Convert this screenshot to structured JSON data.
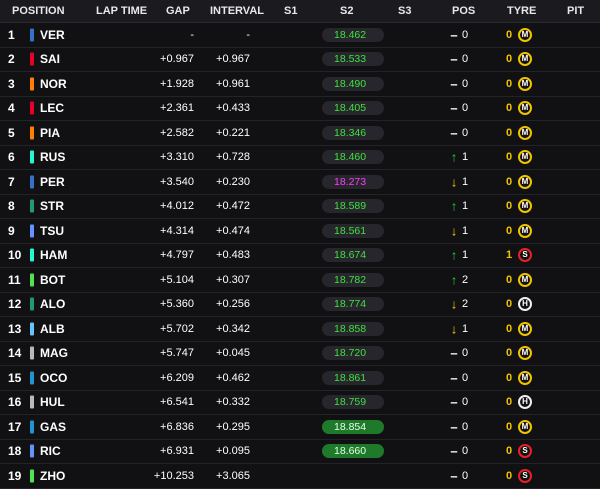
{
  "headers": {
    "position": "POSITION",
    "lap_time": "LAP TIME",
    "gap": "GAP",
    "interval": "INTERVAL",
    "s1": "S1",
    "s2": "S2",
    "s3": "S3",
    "pos": "POS",
    "tyre": "TYRE",
    "pit": "PIT"
  },
  "rows": [
    {
      "pos": "1",
      "code": "VER",
      "team_color": "#3671c6",
      "gap": "-",
      "interval": "-",
      "s2": "18.462",
      "s2_style": "normal",
      "pos_change": "0",
      "direction": "none",
      "pit": "0",
      "tyre": "M",
      "tyre_color": "#f2c400"
    },
    {
      "pos": "2",
      "code": "SAI",
      "team_color": "#e8002d",
      "gap": "+0.967",
      "interval": "+0.967",
      "s2": "18.533",
      "s2_style": "normal",
      "pos_change": "0",
      "direction": "none",
      "pit": "0",
      "tyre": "M",
      "tyre_color": "#f2c400"
    },
    {
      "pos": "3",
      "code": "NOR",
      "team_color": "#ff8000",
      "gap": "+1.928",
      "interval": "+0.961",
      "s2": "18.490",
      "s2_style": "normal",
      "pos_change": "0",
      "direction": "none",
      "pit": "0",
      "tyre": "M",
      "tyre_color": "#f2c400"
    },
    {
      "pos": "4",
      "code": "LEC",
      "team_color": "#e8002d",
      "gap": "+2.361",
      "interval": "+0.433",
      "s2": "18.405",
      "s2_style": "normal",
      "pos_change": "0",
      "direction": "none",
      "pit": "0",
      "tyre": "M",
      "tyre_color": "#f2c400"
    },
    {
      "pos": "5",
      "code": "PIA",
      "team_color": "#ff8000",
      "gap": "+2.582",
      "interval": "+0.221",
      "s2": "18.346",
      "s2_style": "normal",
      "pos_change": "0",
      "direction": "none",
      "pit": "0",
      "tyre": "M",
      "tyre_color": "#f2c400"
    },
    {
      "pos": "6",
      "code": "RUS",
      "team_color": "#27f4d2",
      "gap": "+3.310",
      "interval": "+0.728",
      "s2": "18.460",
      "s2_style": "normal",
      "pos_change": "1",
      "direction": "up",
      "pit": "0",
      "tyre": "M",
      "tyre_color": "#f2c400"
    },
    {
      "pos": "7",
      "code": "PER",
      "team_color": "#3671c6",
      "gap": "+3.540",
      "interval": "+0.230",
      "s2": "18.273",
      "s2_style": "purple",
      "pos_change": "1",
      "direction": "down",
      "pit": "0",
      "tyre": "M",
      "tyre_color": "#f2c400"
    },
    {
      "pos": "8",
      "code": "STR",
      "team_color": "#229971",
      "gap": "+4.012",
      "interval": "+0.472",
      "s2": "18.589",
      "s2_style": "normal",
      "pos_change": "1",
      "direction": "up",
      "pit": "0",
      "tyre": "M",
      "tyre_color": "#f2c400"
    },
    {
      "pos": "9",
      "code": "TSU",
      "team_color": "#6692ff",
      "gap": "+4.314",
      "interval": "+0.474",
      "s2": "18.561",
      "s2_style": "normal",
      "pos_change": "1",
      "direction": "down",
      "pit": "0",
      "tyre": "M",
      "tyre_color": "#f2c400"
    },
    {
      "pos": "10",
      "code": "HAM",
      "team_color": "#27f4d2",
      "gap": "+4.797",
      "interval": "+0.483",
      "s2": "18.674",
      "s2_style": "normal",
      "pos_change": "1",
      "direction": "up",
      "pit": "1",
      "tyre": "S",
      "tyre_color": "#e8202a"
    },
    {
      "pos": "11",
      "code": "BOT",
      "team_color": "#52e252",
      "gap": "+5.104",
      "interval": "+0.307",
      "s2": "18.782",
      "s2_style": "normal",
      "pos_change": "2",
      "direction": "up",
      "pit": "0",
      "tyre": "M",
      "tyre_color": "#f2c400"
    },
    {
      "pos": "12",
      "code": "ALO",
      "team_color": "#229971",
      "gap": "+5.360",
      "interval": "+0.256",
      "s2": "18.774",
      "s2_style": "normal",
      "pos_change": "2",
      "direction": "down",
      "pit": "0",
      "tyre": "H",
      "tyre_color": "#f0f0f0"
    },
    {
      "pos": "13",
      "code": "ALB",
      "team_color": "#64c4ff",
      "gap": "+5.702",
      "interval": "+0.342",
      "s2": "18.858",
      "s2_style": "normal",
      "pos_change": "1",
      "direction": "down",
      "pit": "0",
      "tyre": "M",
      "tyre_color": "#f2c400"
    },
    {
      "pos": "14",
      "code": "MAG",
      "team_color": "#b6babd",
      "gap": "+5.747",
      "interval": "+0.045",
      "s2": "18.720",
      "s2_style": "normal",
      "pos_change": "0",
      "direction": "none",
      "pit": "0",
      "tyre": "M",
      "tyre_color": "#f2c400"
    },
    {
      "pos": "15",
      "code": "OCO",
      "team_color": "#2293d1",
      "gap": "+6.209",
      "interval": "+0.462",
      "s2": "18.861",
      "s2_style": "normal",
      "pos_change": "0",
      "direction": "none",
      "pit": "0",
      "tyre": "M",
      "tyre_color": "#f2c400"
    },
    {
      "pos": "16",
      "code": "HUL",
      "team_color": "#b6babd",
      "gap": "+6.541",
      "interval": "+0.332",
      "s2": "18.759",
      "s2_style": "normal",
      "pos_change": "0",
      "direction": "none",
      "pit": "0",
      "tyre": "H",
      "tyre_color": "#f0f0f0"
    },
    {
      "pos": "17",
      "code": "GAS",
      "team_color": "#2293d1",
      "gap": "+6.836",
      "interval": "+0.295",
      "s2": "18.854",
      "s2_style": "green",
      "pos_change": "0",
      "direction": "none",
      "pit": "0",
      "tyre": "M",
      "tyre_color": "#f2c400"
    },
    {
      "pos": "18",
      "code": "RIC",
      "team_color": "#6692ff",
      "gap": "+6.931",
      "interval": "+0.095",
      "s2": "18.660",
      "s2_style": "green",
      "pos_change": "0",
      "direction": "none",
      "pit": "0",
      "tyre": "S",
      "tyre_color": "#e8202a"
    },
    {
      "pos": "19",
      "code": "ZHO",
      "team_color": "#52e252",
      "gap": "+10.253",
      "interval": "+3.065",
      "s2": "",
      "s2_style": "normal",
      "pos_change": "0",
      "direction": "none",
      "pit": "0",
      "tyre": "S",
      "tyre_color": "#e8202a"
    }
  ]
}
